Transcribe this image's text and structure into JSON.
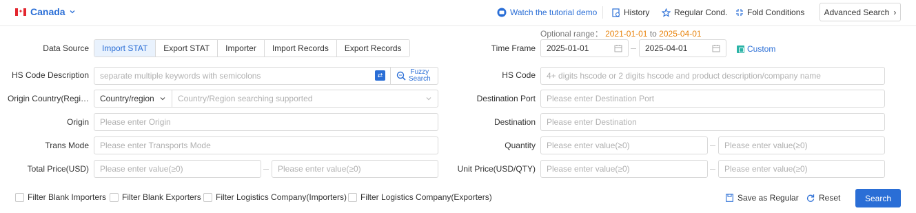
{
  "header": {
    "country": "Canada",
    "tutorial_link": "Watch the tutorial demo",
    "history": "History",
    "regular_cond": "Regular Cond.",
    "fold_conditions": "Fold Conditions",
    "advanced_search": "Advanced Search"
  },
  "data_source": {
    "label": "Data Source",
    "options": [
      "Import STAT",
      "Export STAT",
      "Importer",
      "Import Records",
      "Export Records"
    ],
    "selected": "Import STAT"
  },
  "time_frame": {
    "label": "Time Frame",
    "optional_range_label": "Optional range：",
    "range_start": "2021-01-01",
    "range_to": "to",
    "range_end": "2025-04-01",
    "from": "2025-01-01",
    "to": "2025-04-01",
    "custom": "Custom"
  },
  "fields": {
    "hs_desc": {
      "label": "HS Code Description",
      "placeholder": "separate multiple keywords with semicolons"
    },
    "fuzzy_search": {
      "line1": "Fuzzy",
      "line2": "Search"
    },
    "hs_code": {
      "label": "HS Code",
      "placeholder": "4+ digits hscode or 2 digits hscode and product description/company name"
    },
    "origin_country": {
      "label": "Origin Country(Regi…",
      "type_value": "Country/region",
      "placeholder": "Country/Region searching supported"
    },
    "destination_port": {
      "label": "Destination Port",
      "placeholder": "Please enter Destination Port"
    },
    "origin": {
      "label": "Origin",
      "placeholder": "Please enter Origin"
    },
    "destination": {
      "label": "Destination",
      "placeholder": "Please enter Destination"
    },
    "trans_mode": {
      "label": "Trans Mode",
      "placeholder": "Please enter Transports Mode"
    },
    "quantity": {
      "label": "Quantity",
      "placeholder_min": "Please enter value(≥0)",
      "placeholder_max": "Please enter value(≥0)"
    },
    "total_price": {
      "label": "Total Price(USD)",
      "placeholder_min": "Please enter value(≥0)",
      "placeholder_max": "Please enter value(≥0)"
    },
    "unit_price": {
      "label": "Unit Price(USD/QTY)",
      "placeholder_min": "Please enter value(≥0)",
      "placeholder_max": "Please enter value(≥0)"
    }
  },
  "filters": [
    "Filter Blank Importers",
    "Filter Blank Exporters",
    "Filter Logistics Company(Importers)",
    "Filter Logistics Company(Exporters)"
  ],
  "actions": {
    "save_regular": "Save as Regular",
    "reset": "Reset",
    "search": "Search"
  },
  "colors": {
    "accent": "#2a6ed6",
    "range_highlight": "#e8830c",
    "active_tab_bg": "#e9f2fd"
  }
}
